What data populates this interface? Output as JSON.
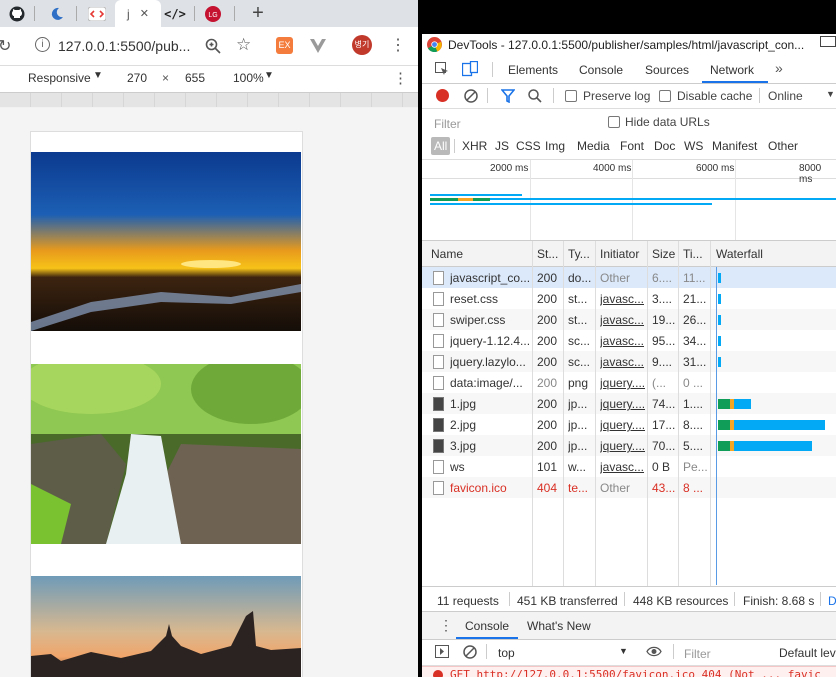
{
  "browser": {
    "tabs": [
      {
        "icon": "github-icon"
      },
      {
        "icon": "moon-icon"
      },
      {
        "icon": "code-icon"
      },
      {
        "label": "j",
        "close": "✕"
      },
      {
        "icon": "code-brackets-icon",
        "label": "</>"
      },
      {
        "icon": "lg-icon",
        "label": "LG"
      }
    ],
    "new_tab": "+",
    "address": "127.0.0.1:5500/pub...",
    "profile_initials": "병기",
    "toolbar": {
      "device": "Responsive",
      "width": "270",
      "times": "×",
      "height": "655",
      "zoom": "100%"
    }
  },
  "devtools": {
    "title": "DevTools - 127.0.0.1:5500/publisher/samples/html/javascript_con...",
    "tabs": [
      "Elements",
      "Console",
      "Sources",
      "Network"
    ],
    "active_tab": "Network",
    "more": "»",
    "preserve_log": "Preserve log",
    "disable_cache": "Disable cache",
    "throttle": "Online",
    "filter_placeholder": "Filter",
    "hide_data_urls": "Hide data URLs",
    "types": [
      "All",
      "XHR",
      "JS",
      "CSS",
      "Img",
      "Media",
      "Font",
      "Doc",
      "WS",
      "Manifest",
      "Other"
    ],
    "timeline_ticks": [
      "2000 ms",
      "4000 ms",
      "6000 ms",
      "8000 ms"
    ],
    "columns": [
      "Name",
      "St...",
      "Ty...",
      "Initiator",
      "Size",
      "Ti...",
      "Waterfall"
    ],
    "rows": [
      {
        "name": "javascript_co...",
        "status": "200",
        "type": "do...",
        "initiator": "Other",
        "size": "6....",
        "time": "11...",
        "icon": "file-icon",
        "wf": [
          0.6,
          0.4
        ]
      },
      {
        "name": "reset.css",
        "status": "200",
        "type": "st...",
        "initiator": "javasc...",
        "size": "3....",
        "time": "21...",
        "icon": "file-icon",
        "wf": [
          0.6,
          0.6
        ]
      },
      {
        "name": "swiper.css",
        "status": "200",
        "type": "st...",
        "initiator": "javasc...",
        "size": "19...",
        "time": "26...",
        "icon": "file-icon",
        "wf": [
          0.6,
          0.6
        ]
      },
      {
        "name": "jquery-1.12.4....",
        "status": "200",
        "type": "sc...",
        "initiator": "javasc...",
        "size": "95...",
        "time": "34...",
        "icon": "file-icon",
        "wf": [
          0.6,
          0.6
        ]
      },
      {
        "name": "jquery.lazylo...",
        "status": "200",
        "type": "sc...",
        "initiator": "javasc...",
        "size": "9....",
        "time": "31...",
        "icon": "file-icon",
        "wf": [
          0.6,
          0.6
        ]
      },
      {
        "name": "data:image/...",
        "status": "200",
        "type": "png",
        "initiator": "jquery....",
        "size": "(...",
        "time": "0 ...",
        "icon": "file-icon",
        "wf": [],
        "muted": true
      },
      {
        "name": "1.jpg",
        "status": "200",
        "type": "jp...",
        "initiator": "jquery....",
        "size": "74...",
        "time": "1....",
        "icon": "image-icon",
        "wf": [
          0.9,
          1.2
        ]
      },
      {
        "name": "2.jpg",
        "status": "200",
        "type": "jp...",
        "initiator": "jquery....",
        "size": "17...",
        "time": "8....",
        "icon": "image-icon",
        "wf": [
          0.9,
          6.5
        ]
      },
      {
        "name": "3.jpg",
        "status": "200",
        "type": "jp...",
        "initiator": "jquery....",
        "size": "70...",
        "time": "5....",
        "icon": "image-icon",
        "wf": [
          0.9,
          5.6
        ]
      },
      {
        "name": "ws",
        "status": "101",
        "type": "w...",
        "initiator": "javasc...",
        "size": "0 B",
        "time": "Pe...",
        "icon": "file-icon",
        "wf": []
      },
      {
        "name": "favicon.ico",
        "status": "404",
        "type": "te...",
        "initiator": "Other",
        "size": "43...",
        "time": "8 ...",
        "icon": "file-icon",
        "wf": [],
        "error": true
      }
    ],
    "summary": [
      "11 requests",
      "451 KB transferred",
      "448 KB resources",
      "Finish: 8.68 s",
      "D"
    ],
    "drawer_tabs": [
      "Console",
      "What's New"
    ],
    "drawer_close": "⋮",
    "console_context": "top",
    "console_filter": "Filter",
    "console_levels": "Default lev",
    "console_error": "GET http://127.0.0.1:5500/favicon.ico 404 (Not ... favic"
  },
  "colors": {
    "accent": "#1a73e8",
    "error": "#d93025",
    "wf_teal": "#0f9d58",
    "wf_blue": "#03a9f4",
    "wf_orange": "#f5a623"
  }
}
